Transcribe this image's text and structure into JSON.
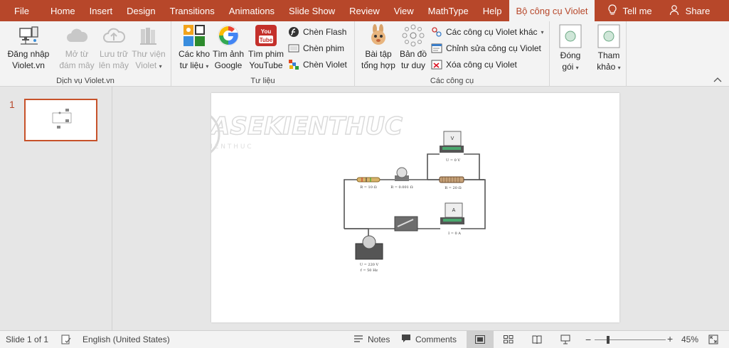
{
  "tabs": [
    "File",
    "Home",
    "Insert",
    "Design",
    "Transitions",
    "Animations",
    "Slide Show",
    "Review",
    "View",
    "MathType",
    "Help",
    "Bộ công cụ Violet"
  ],
  "tell_me": "Tell me",
  "share": "Share",
  "ribbon": {
    "group1": {
      "label": "Dịch vụ Violet.vn",
      "login": [
        "Đăng nhập",
        "Violet.vn"
      ],
      "open_cloud": [
        "Mở từ",
        "đám mây"
      ],
      "save_cloud": [
        "Lưu trữ",
        "lên mây"
      ],
      "library": [
        "Thư viện",
        "Violet"
      ]
    },
    "group2": {
      "label": "Tư liệu",
      "archives": [
        "Các kho",
        "tư liệu"
      ],
      "google_images": [
        "Tìm ảnh",
        "Google"
      ],
      "youtube": [
        "Tìm phim",
        "YouTube"
      ],
      "insert_flash": "Chèn Flash",
      "insert_movie": "Chèn phim",
      "insert_violet": "Chèn Violet",
      "youtube_icon_text": "You Tube"
    },
    "group3": {
      "label": "Các công cụ",
      "exercises": [
        "Bài tập",
        "tổng hợp"
      ],
      "mindmap": [
        "Bản đồ",
        "tư duy"
      ],
      "other_tools": "Các công cụ Violet khác",
      "edit_tools": "Chỉnh sửa công cụ Violet",
      "remove_tools": "Xóa công cụ Violet"
    },
    "pack": [
      "Đóng",
      "gói"
    ],
    "reference": [
      "Tham",
      "khảo"
    ]
  },
  "slide": {
    "number": "1",
    "watermark": "CHIASEKIENTHUC",
    "watermark_sub": "C H I A   S E   K I E N   T H U C",
    "labels": {
      "voltmeter": "U = 0 V",
      "resistor1": "R = 10 Ω",
      "lamp": "R = 0.001 Ω",
      "resistor2": "R = 20 Ω",
      "ammeter": "I = 0 A",
      "source1": "U = 220 V",
      "source2": "f = 50 Hz",
      "voltmeter_letter": "V",
      "ammeter_letter": "A"
    }
  },
  "status": {
    "slide_of": "Slide 1 of 1",
    "language": "English (United States)",
    "notes": "Notes",
    "comments": "Comments",
    "zoom": "45%"
  },
  "colors": {
    "accent": "#b7472a",
    "ribbon_bg": "#f3f3f3"
  }
}
